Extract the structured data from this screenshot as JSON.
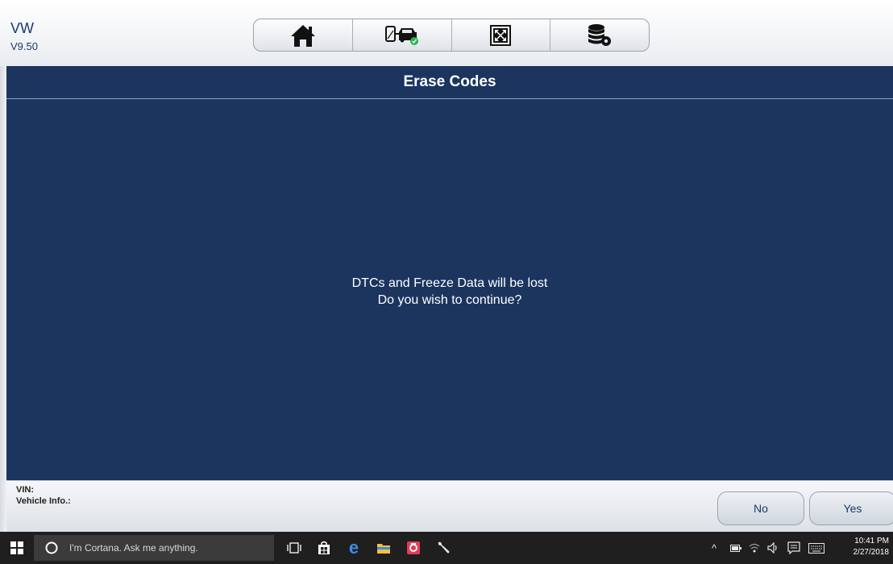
{
  "header": {
    "app_name": "VW",
    "version": "V9.50"
  },
  "toolbar": {
    "buttons": [
      {
        "icon": "home-icon"
      },
      {
        "icon": "vehicle-connection-icon"
      },
      {
        "icon": "fullscreen-icon"
      },
      {
        "icon": "data-settings-icon"
      }
    ]
  },
  "page": {
    "title": "Erase Codes"
  },
  "dialog": {
    "line1": "DTCs and Freeze Data will be lost",
    "line2": "Do you wish to continue?"
  },
  "footer": {
    "vin_label": "VIN:",
    "vehicle_info_label": "Vehicle Info.:",
    "no_label": "No",
    "yes_label": "Yes"
  },
  "taskbar": {
    "search_placeholder": "I'm Cortana. Ask me anything.",
    "time": "10:41 PM",
    "date": "2/27/2018"
  },
  "colors": {
    "main_bg": "#1b355f",
    "accent": "#1a3a6e",
    "taskbar": "#1f1f1f"
  }
}
